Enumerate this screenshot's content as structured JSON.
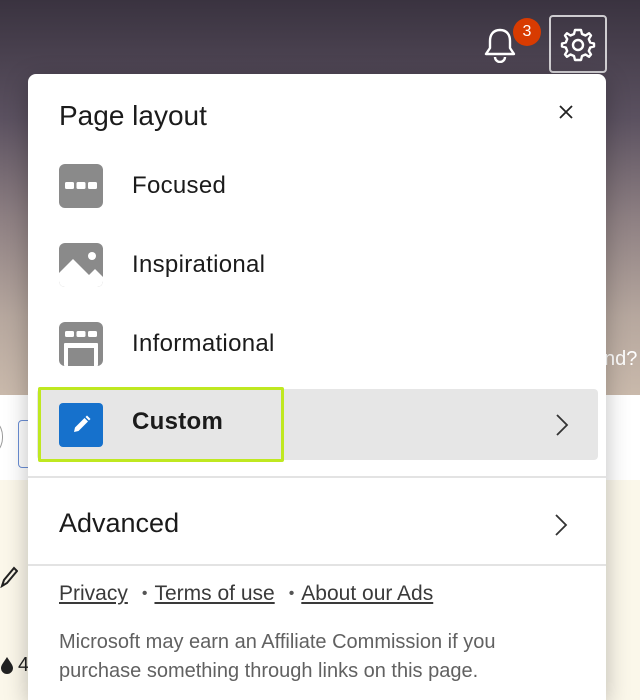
{
  "background": {
    "hero_partial_text": "nd?",
    "stat_partial": "4"
  },
  "header": {
    "notification_count": "3"
  },
  "panel": {
    "title": "Page layout",
    "layouts": [
      {
        "label": "Focused",
        "icon": "focused-layout-icon"
      },
      {
        "label": "Inspirational",
        "icon": "inspirational-layout-icon"
      },
      {
        "label": "Informational",
        "icon": "informational-layout-icon"
      }
    ],
    "custom": {
      "label": "Custom",
      "icon": "pencil-icon"
    },
    "advanced_label": "Advanced",
    "links": {
      "privacy": "Privacy",
      "terms": "Terms of use",
      "ads": "About our Ads"
    },
    "disclaimer": "Microsoft may earn an Affiliate Commission if you purchase something through links on this page."
  },
  "colors": {
    "accent": "#1671cc",
    "highlight_outline": "#bfe820",
    "badge": "#d83b01",
    "selected_row": "#e6e6e6"
  }
}
